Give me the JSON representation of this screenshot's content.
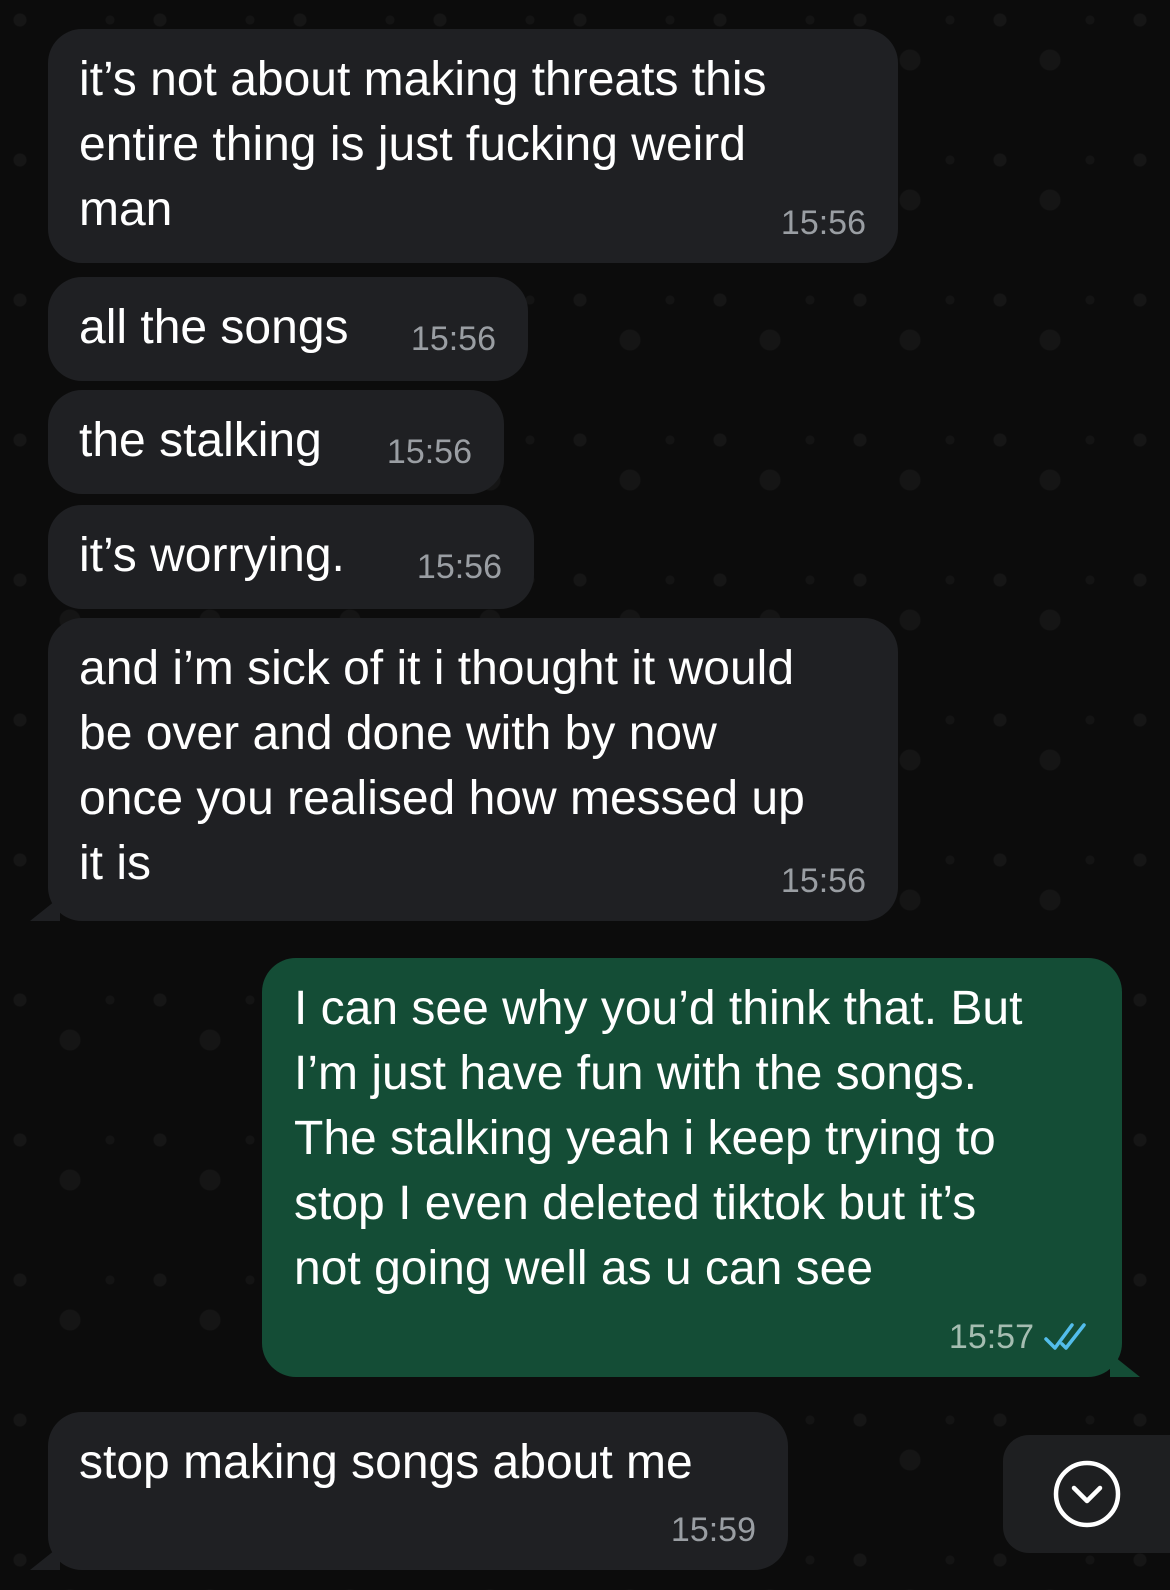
{
  "messages": [
    {
      "direction": "incoming",
      "text": "it’s not about making threats this\nentire thing is just fucking weird\nman",
      "time": "15:56"
    },
    {
      "direction": "incoming",
      "text": "all the songs",
      "time": "15:56"
    },
    {
      "direction": "incoming",
      "text": "the stalking",
      "time": "15:56"
    },
    {
      "direction": "incoming",
      "text": "it’s worrying.",
      "time": "15:56"
    },
    {
      "direction": "incoming",
      "text": "and i’m sick of it i thought it would\nbe over and done with by now\nonce you realised how messed up\nit is",
      "time": "15:56"
    },
    {
      "direction": "outgoing",
      "text": "I can see why you’d think that. But\nI’m just have fun with the songs.\nThe stalking yeah i keep trying to\nstop I even deleted tiktok but it’s\nnot going well as u can see",
      "time": "15:57",
      "status_icon": "double-check-read-icon"
    },
    {
      "direction": "incoming",
      "text": "stop making songs about me",
      "time": "15:59"
    }
  ],
  "scroll_button": {
    "icon": "chevron-down-circle-icon"
  },
  "colors": {
    "incoming_bubble": "#1f2023",
    "outgoing_bubble": "#144d36",
    "read_ticks": "#53bdeb",
    "timestamp": "#9a9ea3"
  }
}
